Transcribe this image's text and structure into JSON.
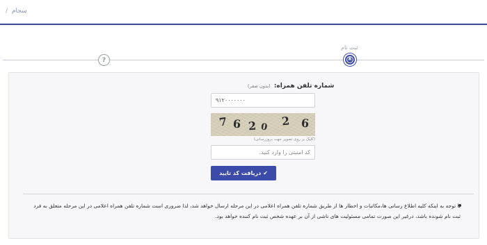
{
  "breadcrumb": {
    "current": "سجام",
    "separator": "/"
  },
  "steps": {
    "active_label": "ثبت نام",
    "active_icon": "registered-icon",
    "pending_icon": "question-icon",
    "active_glyph": "R",
    "pending_glyph": "?"
  },
  "form": {
    "phone_label": "شماره تلفن همراه:",
    "phone_hint": "(بدون صفر)",
    "phone_value": "۹۱۲۰۰۰۰۰۰۰",
    "captcha_digits": [
      "7",
      "6",
      "2",
      "0",
      "2",
      "6"
    ],
    "captcha_hint": "(کلیک بر روی تصویر جهت بروزرسانی)",
    "code_placeholder": "کد امنیتی را وارد کنید.",
    "submit_label": "دریافت کد تایید"
  },
  "notice": {
    "text": "با توجه به اینکه کلیه اطلاع رسانی ها،مکاتبات و اخطار ها از طریق شماره تلفن همراه اعلامی در این مرحله ارسال خواهد شد، لذا ضروری است شماره تلفن همراه اعلامی در این مرحله متعلق به فرد ثبت نام شونده باشد، درغیر این صورت تمامی مسئولیت های ناشی از آن بر عهده شخص ثبت نام کننده خواهد بود."
  },
  "colors": {
    "accent": "#3c4aa8",
    "panel": "#f7f7f9"
  }
}
